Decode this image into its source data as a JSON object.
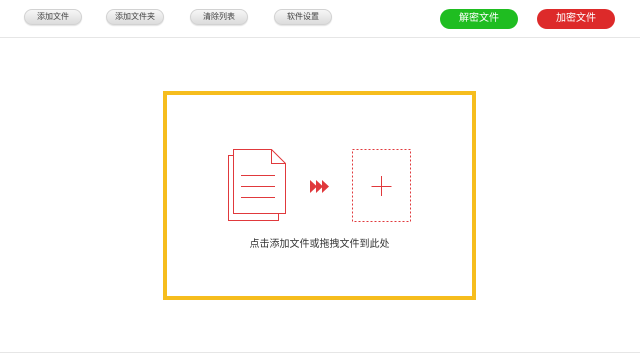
{
  "toolbar": {
    "buttons": [
      {
        "label": "添加文件"
      },
      {
        "label": "添加文件夹"
      },
      {
        "label": "清除列表"
      },
      {
        "label": "软件设置"
      }
    ],
    "decrypt_label": "解密文件",
    "encrypt_label": "加密文件"
  },
  "drop_zone": {
    "hint": "点击添加文件或拖拽文件到此处"
  },
  "colors": {
    "decrypt": "#1fbd21",
    "encrypt": "#dd2a2a",
    "drop_border": "#f6bd1d",
    "icon_red": "#e0393c"
  },
  "icons": [
    "documents-icon",
    "arrows-right-icon",
    "add-plus-icon"
  ]
}
